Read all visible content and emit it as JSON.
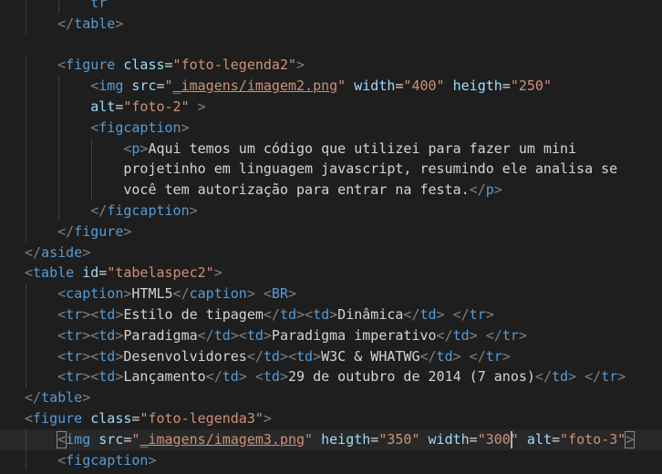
{
  "editor": {
    "lines": [
      {
        "indent": 4,
        "tokens": [
          {
            "t": "tag",
            "v": "tr"
          }
        ]
      },
      {
        "indent": 2,
        "tokens": [
          {
            "t": "br",
            "v": "</"
          },
          {
            "t": "tag",
            "v": "table"
          },
          {
            "t": "br",
            "v": ">"
          }
        ]
      },
      {
        "indent": 0,
        "tokens": []
      },
      {
        "indent": 2,
        "tokens": [
          {
            "t": "br",
            "v": "<"
          },
          {
            "t": "tag",
            "v": "figure"
          },
          {
            "t": "txt",
            "v": " "
          },
          {
            "t": "attr",
            "v": "class"
          },
          {
            "t": "eq",
            "v": "="
          },
          {
            "t": "str",
            "v": "\"foto-legenda2\""
          },
          {
            "t": "br",
            "v": ">"
          }
        ]
      },
      {
        "indent": 4,
        "tokens": [
          {
            "t": "br",
            "v": "<"
          },
          {
            "t": "tag",
            "v": "img"
          },
          {
            "t": "txt",
            "v": " "
          },
          {
            "t": "attr",
            "v": "src"
          },
          {
            "t": "eq",
            "v": "="
          },
          {
            "t": "str",
            "v": "\""
          },
          {
            "t": "link",
            "v": "_imagens/imagem2.png"
          },
          {
            "t": "str",
            "v": "\""
          },
          {
            "t": "txt",
            "v": " "
          },
          {
            "t": "attr",
            "v": "width"
          },
          {
            "t": "eq",
            "v": "="
          },
          {
            "t": "str",
            "v": "\"400\""
          },
          {
            "t": "txt",
            "v": " "
          },
          {
            "t": "attr",
            "v": "heigth"
          },
          {
            "t": "eq",
            "v": "="
          },
          {
            "t": "str",
            "v": "\"250\""
          }
        ]
      },
      {
        "indent": 4,
        "tokens": [
          {
            "t": "attr",
            "v": "alt"
          },
          {
            "t": "eq",
            "v": "="
          },
          {
            "t": "str",
            "v": "\"foto-2\""
          },
          {
            "t": "txt",
            "v": " "
          },
          {
            "t": "br",
            "v": ">"
          }
        ]
      },
      {
        "indent": 4,
        "tokens": [
          {
            "t": "br",
            "v": "<"
          },
          {
            "t": "tag",
            "v": "figcaption"
          },
          {
            "t": "br",
            "v": ">"
          }
        ]
      },
      {
        "indent": 6,
        "tokens": [
          {
            "t": "br",
            "v": "<"
          },
          {
            "t": "tag",
            "v": "p"
          },
          {
            "t": "br",
            "v": ">"
          },
          {
            "t": "txt",
            "v": "Aqui temos um código que utilizei para fazer um mini"
          }
        ]
      },
      {
        "indent": 6,
        "tokens": [
          {
            "t": "txt",
            "v": "projetinho em linguagem javascript, resumindo ele analisa se"
          }
        ]
      },
      {
        "indent": 6,
        "tokens": [
          {
            "t": "txt",
            "v": "você tem autorização para entrar na festa."
          },
          {
            "t": "br",
            "v": "</"
          },
          {
            "t": "tag",
            "v": "p"
          },
          {
            "t": "br",
            "v": ">"
          }
        ]
      },
      {
        "indent": 4,
        "tokens": [
          {
            "t": "br",
            "v": "</"
          },
          {
            "t": "tag",
            "v": "figcaption"
          },
          {
            "t": "br",
            "v": ">"
          }
        ]
      },
      {
        "indent": 2,
        "tokens": [
          {
            "t": "br",
            "v": "</"
          },
          {
            "t": "tag",
            "v": "figure"
          },
          {
            "t": "br",
            "v": ">"
          }
        ]
      },
      {
        "indent": 0,
        "tokens": [
          {
            "t": "br",
            "v": "</"
          },
          {
            "t": "tag",
            "v": "aside"
          },
          {
            "t": "br",
            "v": ">"
          }
        ]
      },
      {
        "indent": 0,
        "tokens": [
          {
            "t": "br",
            "v": "<"
          },
          {
            "t": "tag",
            "v": "table"
          },
          {
            "t": "txt",
            "v": " "
          },
          {
            "t": "attr",
            "v": "id"
          },
          {
            "t": "eq",
            "v": "="
          },
          {
            "t": "str",
            "v": "\"tabelaspec2\""
          },
          {
            "t": "br",
            "v": ">"
          }
        ]
      },
      {
        "indent": 2,
        "tokens": [
          {
            "t": "br",
            "v": "<"
          },
          {
            "t": "tag",
            "v": "caption"
          },
          {
            "t": "br",
            "v": ">"
          },
          {
            "t": "txt",
            "v": "HTML5"
          },
          {
            "t": "br",
            "v": "</"
          },
          {
            "t": "tag",
            "v": "caption"
          },
          {
            "t": "br",
            "v": ">"
          },
          {
            "t": "txt",
            "v": " "
          },
          {
            "t": "br",
            "v": "<"
          },
          {
            "t": "tag",
            "v": "BR"
          },
          {
            "t": "br",
            "v": ">"
          }
        ]
      },
      {
        "indent": 2,
        "tokens": [
          {
            "t": "br",
            "v": "<"
          },
          {
            "t": "tag",
            "v": "tr"
          },
          {
            "t": "br",
            "v": "><"
          },
          {
            "t": "tag",
            "v": "td"
          },
          {
            "t": "br",
            "v": ">"
          },
          {
            "t": "txt",
            "v": "Estilo de tipagem"
          },
          {
            "t": "br",
            "v": "</"
          },
          {
            "t": "tag",
            "v": "td"
          },
          {
            "t": "br",
            "v": "><"
          },
          {
            "t": "tag",
            "v": "td"
          },
          {
            "t": "br",
            "v": ">"
          },
          {
            "t": "txt",
            "v": "Dinâmica"
          },
          {
            "t": "br",
            "v": "</"
          },
          {
            "t": "tag",
            "v": "td"
          },
          {
            "t": "br",
            "v": ">"
          },
          {
            "t": "txt",
            "v": " "
          },
          {
            "t": "br",
            "v": "</"
          },
          {
            "t": "tag",
            "v": "tr"
          },
          {
            "t": "br",
            "v": ">"
          }
        ]
      },
      {
        "indent": 2,
        "tokens": [
          {
            "t": "br",
            "v": "<"
          },
          {
            "t": "tag",
            "v": "tr"
          },
          {
            "t": "br",
            "v": "><"
          },
          {
            "t": "tag",
            "v": "td"
          },
          {
            "t": "br",
            "v": ">"
          },
          {
            "t": "txt",
            "v": "Paradigma"
          },
          {
            "t": "br",
            "v": "</"
          },
          {
            "t": "tag",
            "v": "td"
          },
          {
            "t": "br",
            "v": "><"
          },
          {
            "t": "tag",
            "v": "td"
          },
          {
            "t": "br",
            "v": ">"
          },
          {
            "t": "txt",
            "v": "Paradigma imperativo"
          },
          {
            "t": "br",
            "v": "</"
          },
          {
            "t": "tag",
            "v": "td"
          },
          {
            "t": "br",
            "v": ">"
          },
          {
            "t": "txt",
            "v": " "
          },
          {
            "t": "br",
            "v": "</"
          },
          {
            "t": "tag",
            "v": "tr"
          },
          {
            "t": "br",
            "v": ">"
          }
        ]
      },
      {
        "indent": 2,
        "tokens": [
          {
            "t": "br",
            "v": "<"
          },
          {
            "t": "tag",
            "v": "tr"
          },
          {
            "t": "br",
            "v": "><"
          },
          {
            "t": "tag",
            "v": "td"
          },
          {
            "t": "br",
            "v": ">"
          },
          {
            "t": "txt",
            "v": "Desenvolvidores"
          },
          {
            "t": "br",
            "v": "</"
          },
          {
            "t": "tag",
            "v": "td"
          },
          {
            "t": "br",
            "v": "><"
          },
          {
            "t": "tag",
            "v": "td"
          },
          {
            "t": "br",
            "v": ">"
          },
          {
            "t": "txt",
            "v": "W3C & WHATWG"
          },
          {
            "t": "br",
            "v": "</"
          },
          {
            "t": "tag",
            "v": "td"
          },
          {
            "t": "br",
            "v": ">"
          },
          {
            "t": "txt",
            "v": " "
          },
          {
            "t": "br",
            "v": "</"
          },
          {
            "t": "tag",
            "v": "tr"
          },
          {
            "t": "br",
            "v": ">"
          }
        ]
      },
      {
        "indent": 2,
        "tokens": [
          {
            "t": "br",
            "v": "<"
          },
          {
            "t": "tag",
            "v": "tr"
          },
          {
            "t": "br",
            "v": "><"
          },
          {
            "t": "tag",
            "v": "td"
          },
          {
            "t": "br",
            "v": ">"
          },
          {
            "t": "txt",
            "v": "Lançamento"
          },
          {
            "t": "br",
            "v": "</"
          },
          {
            "t": "tag",
            "v": "td"
          },
          {
            "t": "br",
            "v": ">"
          },
          {
            "t": "txt",
            "v": " "
          },
          {
            "t": "br",
            "v": "<"
          },
          {
            "t": "tag",
            "v": "td"
          },
          {
            "t": "br",
            "v": ">"
          },
          {
            "t": "txt",
            "v": "29 de outubro de 2014 (7 anos)"
          },
          {
            "t": "br",
            "v": "</"
          },
          {
            "t": "tag",
            "v": "td"
          },
          {
            "t": "br",
            "v": ">"
          },
          {
            "t": "txt",
            "v": " "
          },
          {
            "t": "br",
            "v": "</"
          },
          {
            "t": "tag",
            "v": "tr"
          },
          {
            "t": "br",
            "v": ">"
          }
        ]
      },
      {
        "indent": 0,
        "tokens": [
          {
            "t": "br",
            "v": "</"
          },
          {
            "t": "tag",
            "v": "table"
          },
          {
            "t": "br",
            "v": ">"
          }
        ]
      },
      {
        "indent": 0,
        "tokens": [
          {
            "t": "br",
            "v": "<"
          },
          {
            "t": "tag",
            "v": "figure"
          },
          {
            "t": "txt",
            "v": " "
          },
          {
            "t": "attr",
            "v": "class"
          },
          {
            "t": "eq",
            "v": "="
          },
          {
            "t": "str",
            "v": "\"foto-legenda3\""
          },
          {
            "t": "br",
            "v": ">"
          }
        ]
      },
      {
        "indent": 2,
        "tokens": [
          {
            "t": "br",
            "v": "<"
          },
          {
            "t": "tag",
            "v": "img"
          },
          {
            "t": "txt",
            "v": " "
          },
          {
            "t": "attr",
            "v": "src"
          },
          {
            "t": "eq",
            "v": "="
          },
          {
            "t": "str",
            "v": "\""
          },
          {
            "t": "link",
            "v": "_imagens/imagem3.png"
          },
          {
            "t": "str",
            "v": "\""
          },
          {
            "t": "txt",
            "v": " "
          },
          {
            "t": "attr",
            "v": "heigth"
          },
          {
            "t": "eq",
            "v": "="
          },
          {
            "t": "str",
            "v": "\"350\""
          },
          {
            "t": "txt",
            "v": " "
          },
          {
            "t": "attr",
            "v": "width"
          },
          {
            "t": "eq",
            "v": "="
          },
          {
            "t": "str",
            "v": "\"300\""
          },
          {
            "t": "txt",
            "v": " "
          },
          {
            "t": "attr",
            "v": "alt"
          },
          {
            "t": "eq",
            "v": "="
          },
          {
            "t": "str",
            "v": "\"foto-3\""
          },
          {
            "t": "br",
            "v": ">"
          }
        ]
      },
      {
        "indent": 2,
        "tokens": [
          {
            "t": "br",
            "v": "<"
          },
          {
            "t": "tag",
            "v": "figcaption"
          },
          {
            "t": "br",
            "v": ">"
          }
        ]
      }
    ],
    "current_line": 21
  },
  "colors": {
    "background": "#1e1e1e",
    "tag": "#569cd6",
    "bracket": "#808080",
    "attribute": "#9cdcfe",
    "string": "#ce9178",
    "text": "#d4d4d4"
  }
}
